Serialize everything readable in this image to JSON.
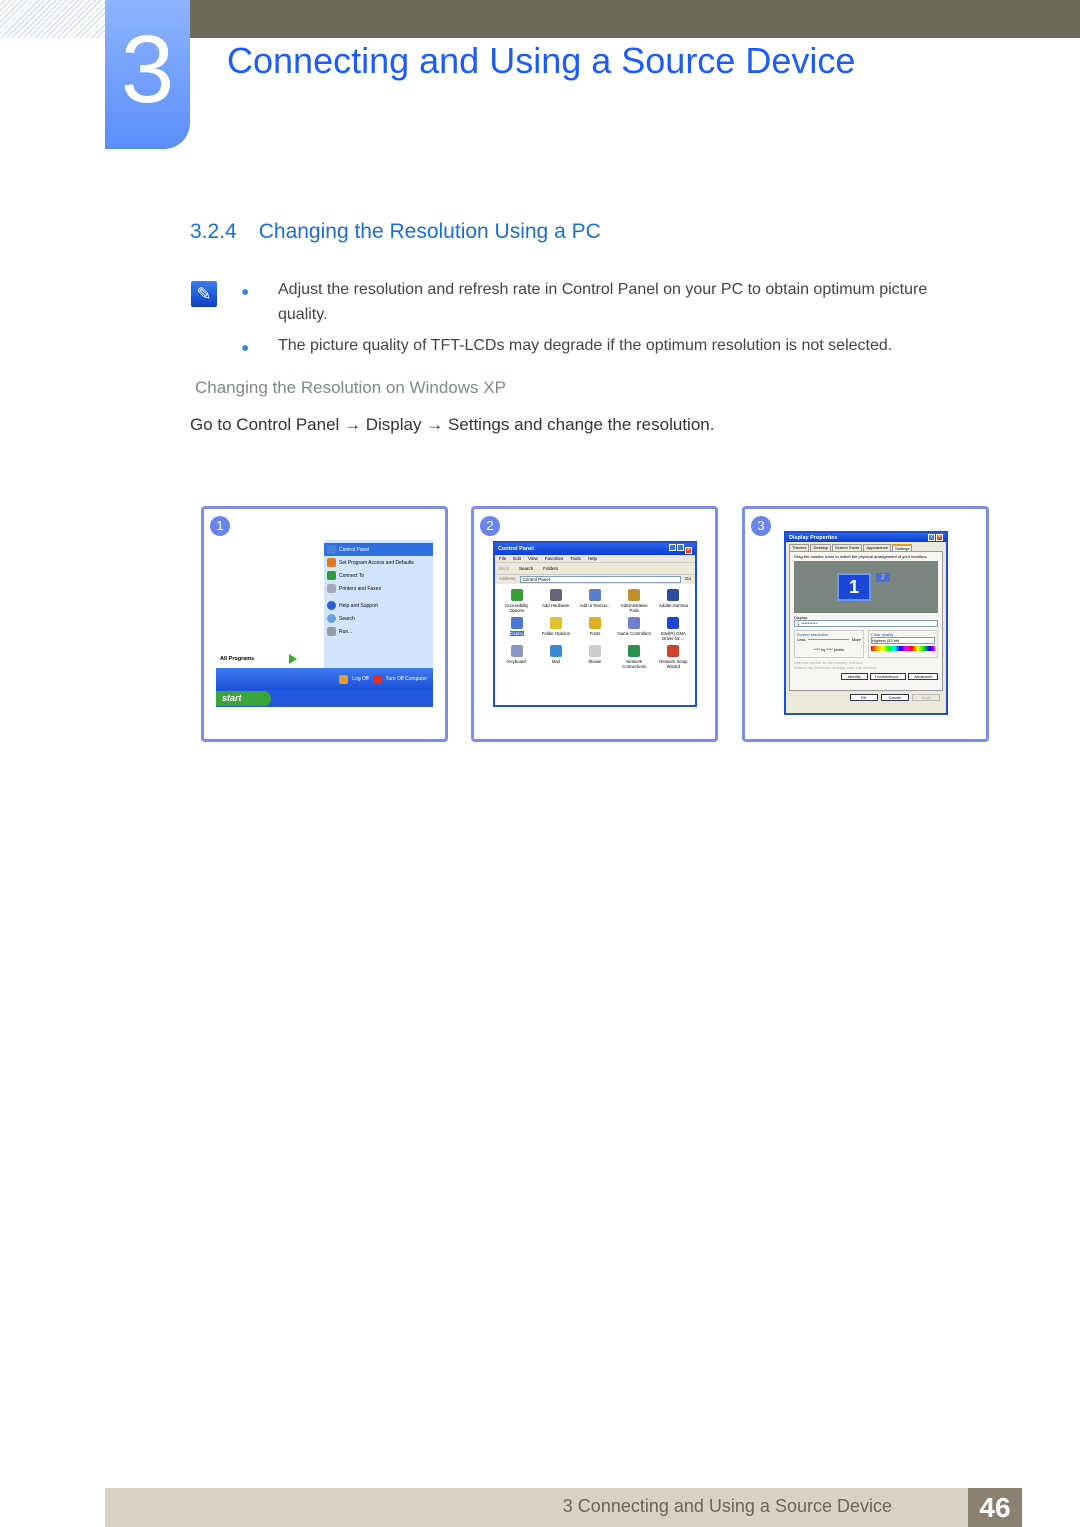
{
  "chapter": {
    "number": "3",
    "title": "Connecting and Using a Source Device"
  },
  "section": {
    "number": "3.2.4",
    "title": "Changing the Resolution Using a PC"
  },
  "note": {
    "icon": "note-pencil-icon",
    "bullets": [
      "Adjust the resolution and refresh rate in Control Panel on your PC to obtain optimum picture quality.",
      "The picture quality of TFT-LCDs may degrade if the optimum resolution is not selected."
    ]
  },
  "subheading": "Changing the Resolution on Windows XP",
  "instruction": "Go to Control Panel → Display → Settings and change the resolution.",
  "steps": [
    {
      "number": "1",
      "start_menu": {
        "items": [
          "Control Panel",
          "Set Program Access and Defaults",
          "Connect To",
          "Printers and Faxes",
          "Help and Support",
          "Search",
          "Run..."
        ],
        "all_programs": "All Programs",
        "log_off": "Log Off",
        "turn_off": "Turn Off Computer",
        "start": "start"
      }
    },
    {
      "number": "2",
      "window": {
        "title": "Control Panel",
        "menu": [
          "File",
          "Edit",
          "View",
          "Favorites",
          "Tools",
          "Help"
        ],
        "toolbar": [
          "Back",
          "Search",
          "Folders"
        ],
        "address_label": "Address",
        "address": "Control Panel",
        "go": "Go",
        "icons": [
          "Accessibility Options",
          "Add Hardware",
          "Add or Remov...",
          "Administrative Tools",
          "Adobe Gamma",
          "Display",
          "Folder Options",
          "Fonts",
          "Game Controllers",
          "Intel(R) GMA Driver for ...",
          "Keyboard",
          "Mail",
          "Mouse",
          "Network Connections",
          "Network Setup Wizard"
        ]
      }
    },
    {
      "number": "3",
      "dialog": {
        "title": "Display Properties",
        "tabs": [
          "Themes",
          "Desktop",
          "Screen Saver",
          "Appearance",
          "Settings"
        ],
        "instruction": "Drag the monitor icons to match the physical arrangement of your monitors.",
        "monitor1": "1",
        "monitor2": "2",
        "display_label": "Display:",
        "display_value": "1. **********",
        "resolution_label": "Screen resolution",
        "less": "Less",
        "more": "More",
        "resolution_value": "**** by **** pixels",
        "color_label": "Color quality",
        "color_value": "Highest (32 bit)",
        "check1": "Use this device as the primary monitor.",
        "check2": "Extend my Windows desktop onto this monitor.",
        "buttons": [
          "Identify",
          "Troubleshoot...",
          "Advanced"
        ],
        "footer_buttons": [
          "OK",
          "Cancel",
          "Apply"
        ]
      }
    }
  ],
  "footer": {
    "text": "3 Connecting and Using a Source Device",
    "page": "46"
  },
  "colors": {
    "accent": "#1a5cff",
    "panel_border": "#7c8ef0",
    "topbar": "#6e6a58",
    "footer": "#d8d3c2"
  }
}
